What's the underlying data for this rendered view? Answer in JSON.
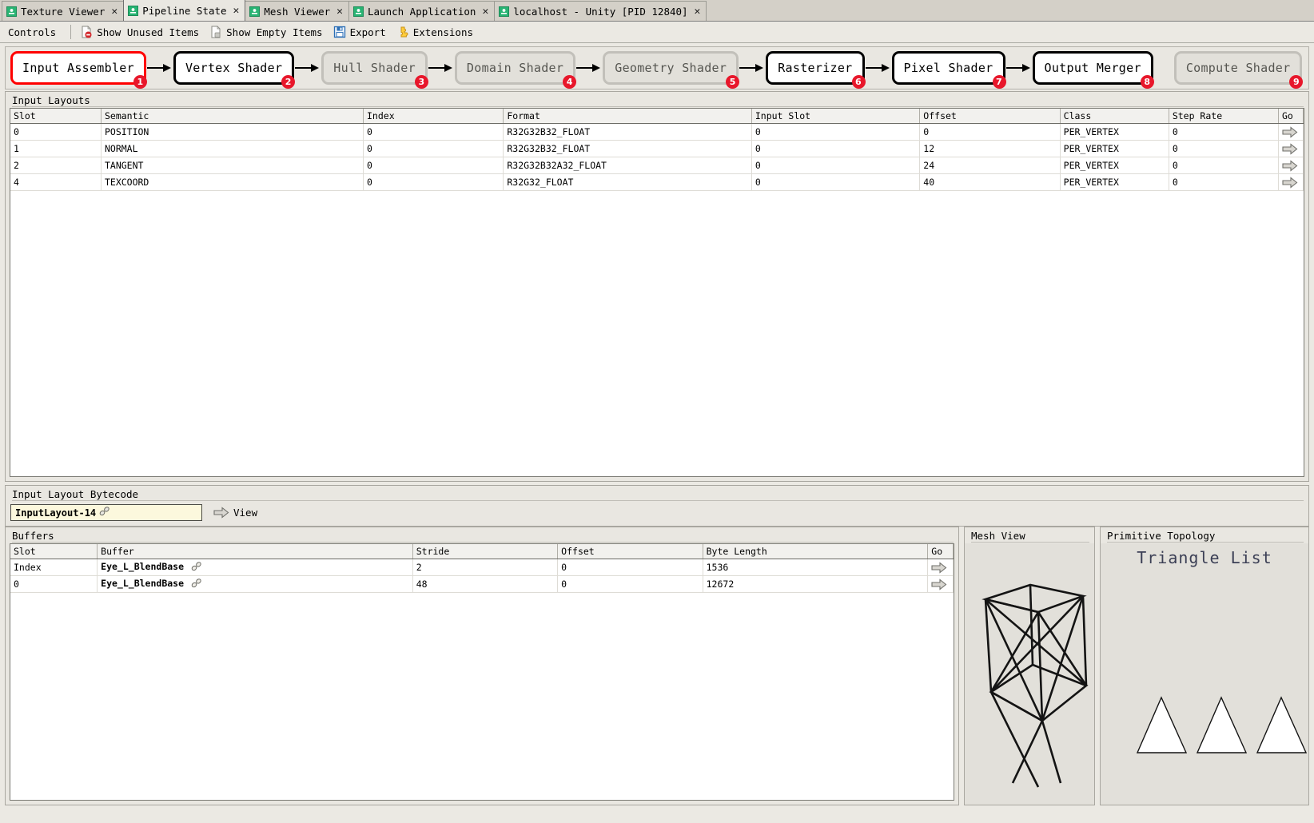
{
  "window": {
    "tabs": [
      {
        "label": "Texture Viewer",
        "icon": "renderdoc-tab-icon",
        "active": false,
        "closable": true
      },
      {
        "label": "Pipeline State",
        "icon": "renderdoc-tab-icon",
        "active": true,
        "closable": true
      },
      {
        "label": "Mesh Viewer",
        "icon": "renderdoc-tab-icon",
        "active": false,
        "closable": true
      },
      {
        "label": "Launch Application",
        "icon": "renderdoc-tab-icon",
        "active": false,
        "closable": true
      },
      {
        "label": "localhost - Unity [PID 12840]",
        "icon": "renderdoc-tab-icon",
        "active": false,
        "closable": true
      }
    ],
    "close_glyph": "✕"
  },
  "toolbar": {
    "controls_label": "Controls",
    "items": [
      {
        "label": "Show Unused Items",
        "icon": "show-unused-items-icon"
      },
      {
        "label": "Show Empty Items",
        "icon": "show-empty-items-icon"
      },
      {
        "label": "Export",
        "icon": "export-icon"
      },
      {
        "label": "Extensions",
        "icon": "extensions-icon"
      }
    ]
  },
  "pipeline": {
    "stages": [
      {
        "label": "Input Assembler",
        "badge": "1",
        "state": "current"
      },
      {
        "label": "Vertex Shader",
        "badge": "2",
        "state": "active"
      },
      {
        "label": "Hull Shader",
        "badge": "3",
        "state": "inactive"
      },
      {
        "label": "Domain Shader",
        "badge": "4",
        "state": "inactive"
      },
      {
        "label": "Geometry Shader",
        "badge": "5",
        "state": "inactive"
      },
      {
        "label": "Rasterizer",
        "badge": "6",
        "state": "active"
      },
      {
        "label": "Pixel Shader",
        "badge": "7",
        "state": "active"
      },
      {
        "label": "Output Merger",
        "badge": "8",
        "state": "active"
      },
      {
        "label": "Compute Shader",
        "badge": "9",
        "state": "inactive"
      }
    ],
    "colors": {
      "current_border": "#ff0000",
      "active_border": "#000000",
      "inactive_border": "#c2c0ba",
      "badge_bg": "#e8172b"
    }
  },
  "input_layouts": {
    "title": "Input Layouts",
    "columns": [
      "Slot",
      "Semantic",
      "Index",
      "Format",
      "Input Slot",
      "Offset",
      "Class",
      "Step Rate",
      "Go"
    ],
    "rows": [
      {
        "slot": "0",
        "semantic": "POSITION",
        "index": "0",
        "format": "R32G32B32_FLOAT",
        "input_slot": "0",
        "offset": "0",
        "class": "PER_VERTEX",
        "step_rate": "0"
      },
      {
        "slot": "1",
        "semantic": "NORMAL",
        "index": "0",
        "format": "R32G32B32_FLOAT",
        "input_slot": "0",
        "offset": "12",
        "class": "PER_VERTEX",
        "step_rate": "0"
      },
      {
        "slot": "2",
        "semantic": "TANGENT",
        "index": "0",
        "format": "R32G32B32A32_FLOAT",
        "input_slot": "0",
        "offset": "24",
        "class": "PER_VERTEX",
        "step_rate": "0"
      },
      {
        "slot": "4",
        "semantic": "TEXCOORD",
        "index": "0",
        "format": "R32G32_FLOAT",
        "input_slot": "0",
        "offset": "40",
        "class": "PER_VERTEX",
        "step_rate": "0"
      }
    ]
  },
  "bytecode": {
    "title": "Input Layout Bytecode",
    "name": "InputLayout-14",
    "view_label": "View"
  },
  "buffers": {
    "title": "Buffers",
    "columns": [
      "Slot",
      "Buffer",
      "Stride",
      "Offset",
      "Byte Length",
      "Go"
    ],
    "rows": [
      {
        "slot": "Index",
        "buffer": "Eye_L_BlendBase",
        "stride": "2",
        "offset": "0",
        "byte_length": "1536"
      },
      {
        "slot": "0",
        "buffer": "Eye_L_BlendBase",
        "stride": "48",
        "offset": "0",
        "byte_length": "12672"
      }
    ]
  },
  "mesh_view": {
    "title": "Mesh View",
    "shape": "wireframe-cube"
  },
  "primitive_topology": {
    "title": "Primitive Topology",
    "value": "Triangle List",
    "value_color": "#3b3f55",
    "triangle_count": 3
  }
}
